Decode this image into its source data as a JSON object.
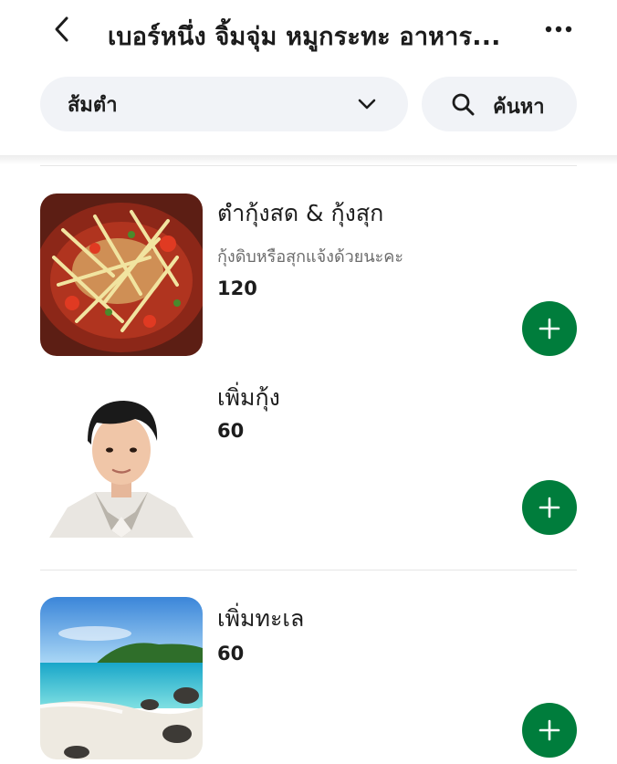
{
  "header": {
    "title": "เบอร์หนึ่ง จิ้มจุ่ม หมูกระทะ อาหาร...",
    "back_icon": "chevron-left-icon",
    "more_icon": "more-horizontal-icon"
  },
  "controls": {
    "category_selected": "ส้มตำ",
    "search_label": "ค้นหา"
  },
  "items": [
    {
      "name": "ตำกุ้งสด & กุ้งสุก",
      "description": "กุ้งดิบหรือสุกแจ้งด้วยนะคะ",
      "price": "120"
    },
    {
      "name": "เพิ่มกุ้ง",
      "price": "60"
    },
    {
      "name": "เพิ่มทะเล",
      "price": "60"
    }
  ],
  "colors": {
    "accent": "#007d3c",
    "control_bg": "#f1f3f7"
  }
}
